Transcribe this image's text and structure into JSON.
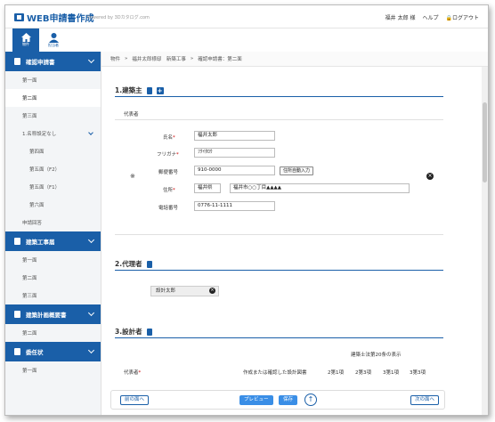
{
  "header": {
    "app_title": "WEB申請書作成",
    "powered": "Powered by 3Dカタログ.com",
    "user_name": "福井 太郎 様",
    "help": "ヘルプ",
    "logout": "ログアウト"
  },
  "nav": {
    "home": "物件",
    "user": "担当者"
  },
  "sidebar": {
    "sec1": "確認申請書",
    "sec1_items": [
      "第一面",
      "第二面",
      "第三面",
      "1.名称設定なし",
      "第四面",
      "第五面（F2）",
      "第五面（F1）",
      "第六面",
      "申請回答"
    ],
    "sec2": "建築工事届",
    "sec2_items": [
      "第一面",
      "第二面",
      "第三面"
    ],
    "sec3": "建築計画概要書",
    "sec3_items": [
      "第二面"
    ],
    "sec4": "委任状",
    "sec4_items": [
      "第一面"
    ]
  },
  "breadcrumb": [
    "物件",
    "福井太郎様邸　新築工事",
    "確認申請書：第二面"
  ],
  "s1": {
    "title": "1.建築主",
    "rep": "代表者",
    "marker": "※",
    "name_label": "氏名",
    "name": "福井太郎",
    "furi_label": "フリガナ",
    "furi": "ﾌｸｲﾀﾛｳ",
    "zip_label": "郵便番号",
    "zip": "910-0000",
    "zip_button": "住所自動入力",
    "addr_label": "住所",
    "pref": "福井県",
    "addr": "福井市○○丁目▲▲▲▲",
    "tel_label": "電話番号",
    "tel": "0776-11-1111"
  },
  "s2": {
    "title": "2.代理者",
    "agent": "設計太郎"
  },
  "s3": {
    "title": "3.設計者",
    "law": "建築士法第20条の表示",
    "rep": "代表者",
    "col_design": "作成または確認した設計図書",
    "cols": [
      "2第1項",
      "2第3項",
      "3第1項",
      "3第3項"
    ]
  },
  "footer": {
    "prev": "前の面へ",
    "preview": "プレビュー",
    "save": "保存",
    "up": "↑",
    "next": "次の面へ"
  }
}
